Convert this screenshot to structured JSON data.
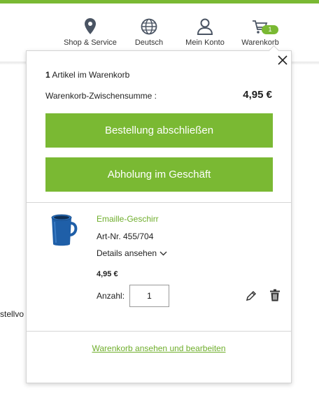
{
  "header": {
    "nav": {
      "shop_label": "Shop & Service",
      "lang_label": "Deutsch",
      "account_label": "Mein Konto",
      "cart_label": "Warenkorb",
      "cart_badge": "1"
    }
  },
  "background": {
    "partial_text": "stellvo"
  },
  "cart": {
    "summary": {
      "count": "1",
      "count_label": " Artikel im Warenkorb"
    },
    "subtotal_label": "Warenkorb-Zwischensumme :",
    "subtotal_value": "4,95 €",
    "checkout_button": "Bestellung abschließen",
    "pickup_button": "Abholung im Geschäft",
    "item": {
      "name": "Emaille-Geschirr",
      "article_no": "Art-Nr. 455/704",
      "details_label": "Details ansehen",
      "price": "4,95 €",
      "qty_label": "Anzahl:",
      "qty_value": "1"
    },
    "view_edit_link": "Warenkorb ansehen und bearbeiten"
  },
  "colors": {
    "accent": "#7ab933",
    "link": "#6fae2c",
    "product_blue": "#1f5fa8"
  },
  "icons": [
    "location-pin-icon",
    "globe-icon",
    "user-icon",
    "cart-icon",
    "close-icon",
    "chevron-down-icon",
    "pencil-icon",
    "trash-icon"
  ]
}
